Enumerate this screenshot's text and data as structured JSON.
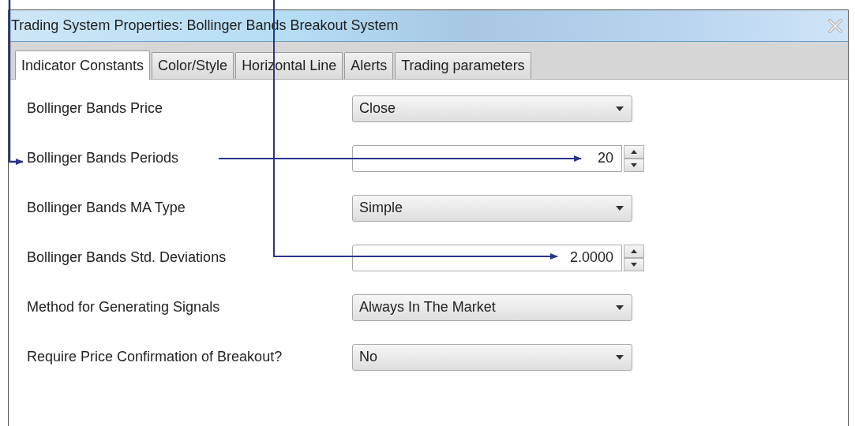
{
  "window": {
    "title": "Trading System Properties: Bollinger Bands Breakout System"
  },
  "tabs": [
    {
      "label": "Indicator Constants",
      "selected": true
    },
    {
      "label": "Color/Style",
      "selected": false
    },
    {
      "label": "Horizontal Line",
      "selected": false
    },
    {
      "label": "Alerts",
      "selected": false
    },
    {
      "label": "Trading parameters",
      "selected": false
    }
  ],
  "fields": [
    {
      "label": "Bollinger Bands Price",
      "kind": "dropdown",
      "value": "Close"
    },
    {
      "label": "Bollinger Bands Periods",
      "kind": "spinner",
      "value": "20"
    },
    {
      "label": "Bollinger Bands MA Type",
      "kind": "dropdown",
      "value": "Simple"
    },
    {
      "label": "Bollinger Bands Std. Deviations",
      "kind": "spinner",
      "value": "2.0000"
    },
    {
      "label": "Method for Generating Signals",
      "kind": "dropdown",
      "value": "Always In The Market"
    },
    {
      "label": "Require Price Confirmation of Breakout?",
      "kind": "dropdown",
      "value": "No"
    }
  ]
}
